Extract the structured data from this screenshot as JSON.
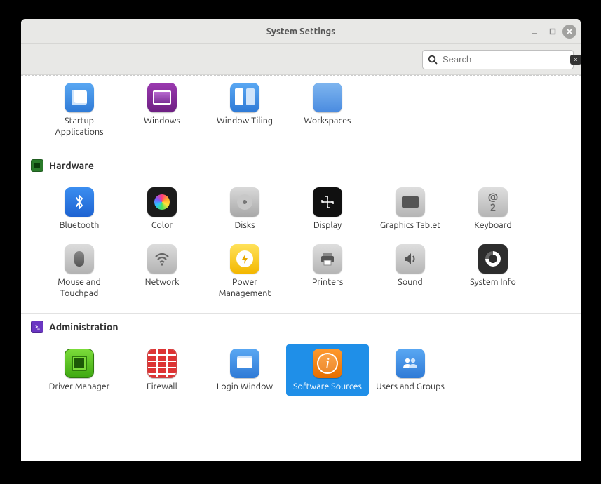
{
  "window": {
    "title": "System Settings"
  },
  "search": {
    "placeholder": "Search",
    "value": ""
  },
  "sections": {
    "cut": {
      "items": [
        {
          "label": "Startup Applications"
        },
        {
          "label": "Windows"
        },
        {
          "label": "Window Tiling"
        },
        {
          "label": "Workspaces"
        }
      ]
    },
    "hardware": {
      "title": "Hardware",
      "items": [
        {
          "label": "Bluetooth"
        },
        {
          "label": "Color"
        },
        {
          "label": "Disks"
        },
        {
          "label": "Display"
        },
        {
          "label": "Graphics Tablet"
        },
        {
          "label": "Keyboard"
        },
        {
          "label": "Mouse and Touchpad"
        },
        {
          "label": "Network"
        },
        {
          "label": "Power Management"
        },
        {
          "label": "Printers"
        },
        {
          "label": "Sound"
        },
        {
          "label": "System Info"
        }
      ]
    },
    "administration": {
      "title": "Administration",
      "items": [
        {
          "label": "Driver Manager"
        },
        {
          "label": "Firewall"
        },
        {
          "label": "Login Window"
        },
        {
          "label": "Software Sources",
          "selected": true
        },
        {
          "label": "Users and Groups"
        }
      ]
    }
  },
  "keyboard_glyph": "@\n2"
}
